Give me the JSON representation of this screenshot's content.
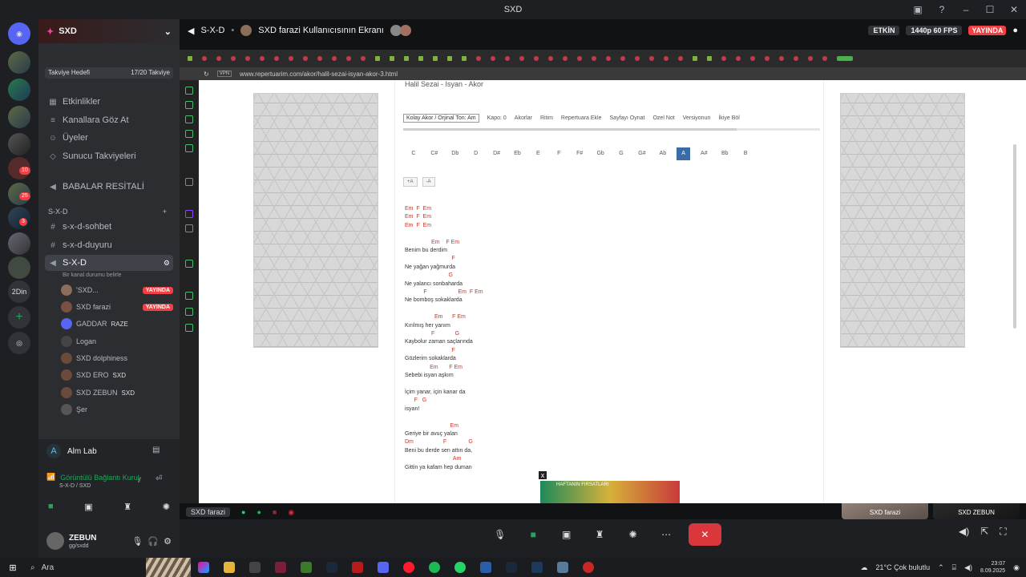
{
  "window": {
    "title": "SXD"
  },
  "server": {
    "name": "SXD",
    "boost_label": "Takviye Hedefi",
    "boost_count": "17/20 Takviye"
  },
  "nav": [
    {
      "label": "Etkinlikler",
      "icon": "calendar-icon"
    },
    {
      "label": "Kanallara Göz At",
      "icon": "browse-icon"
    },
    {
      "label": "Üyeler",
      "icon": "members-icon"
    },
    {
      "label": "Sunucu Takviyeleri",
      "icon": "boost-icon"
    }
  ],
  "channel_top": "BABALAR RESİTALİ",
  "category": "S-X-D",
  "text_channels": [
    "s-x-d-sohbet",
    "s-x-d-duyuru"
  ],
  "voice_channel": {
    "name": "S-X-D",
    "status": "Bir kanal durumu belirle"
  },
  "voice_users": [
    {
      "name": "'SXD...",
      "live": "YAYINDA"
    },
    {
      "name": "SXD farazi",
      "live": "YAYINDA"
    },
    {
      "name": "GADDAR",
      "tag": "RAZE"
    },
    {
      "name": "Logan",
      "tag": ""
    },
    {
      "name": "SXD dolphiness",
      "tag": ""
    },
    {
      "name": "SXD ERO",
      "tag": "SXD"
    },
    {
      "name": "SXD ZEBUN",
      "tag": "SXD"
    },
    {
      "name": "Şer",
      "tag": ""
    }
  ],
  "voice_panel": {
    "app": "Alm Lab",
    "status": "Görüntülü Bağlantı Kurul",
    "sub": "S-X-D / SXD"
  },
  "user": {
    "name": "ZEBUN",
    "status": "gg/sxdd"
  },
  "stream": {
    "title": "S-X-D",
    "viewer": "SXD farazi Kullanıcısının Ekranı",
    "quality": "1440p 60 FPS",
    "live": "YAYINDA",
    "activity": "ETKİN"
  },
  "browser": {
    "url": "www.repertuarim.com/akor/halil-sezai-isyan-akor-3.html"
  },
  "song": {
    "title": "Halil Sezai - Isyan - Akor",
    "select": "Kolay Akor / Orjinal Ton: Am",
    "capo": "Kapo: 0",
    "tools": [
      "Akorlar",
      "Ritim",
      "Repertuara Ekle",
      "Sayfayı Oynat",
      "Ozel Not",
      "Versiyonun",
      "İkiye Böl"
    ],
    "keys": [
      "C",
      "C#",
      "Db",
      "D",
      "D#",
      "Eb",
      "E",
      "F",
      "F#",
      "Gb",
      "G",
      "G#",
      "Ab",
      "A",
      "A#",
      "Bb",
      "B"
    ],
    "active_key": "A",
    "transpose": [
      "+A",
      "-A"
    ],
    "lines": [
      {
        "c": "Em  F  Em"
      },
      {
        "c": "Em  F  Em"
      },
      {
        "c": "Em  F  Em"
      },
      {
        "t": ""
      },
      {
        "c": "                 Em    F Em"
      },
      {
        "t": "Benim bu derdim"
      },
      {
        "c": "                              F"
      },
      {
        "t": "Ne yağan yağmurda"
      },
      {
        "c": "                            G"
      },
      {
        "t": "Ne yalancı sonbaharda"
      },
      {
        "c": "            F                    Em  F Em"
      },
      {
        "t": "Ne bomboş sokaklarda"
      },
      {
        "t": ""
      },
      {
        "c": "                   Em      F Em"
      },
      {
        "t": "Kırılmış her yanım"
      },
      {
        "c": "                 F             G"
      },
      {
        "t": "Kaybolur zaman saçlarında"
      },
      {
        "c": "                              F"
      },
      {
        "t": "Gözlerim sokaklarda"
      },
      {
        "c": "                Em       F Em"
      },
      {
        "t": "Sebebi isyan aşkım"
      },
      {
        "t": ""
      },
      {
        "t": "İçim yanar, için kanar da"
      },
      {
        "c": "      F   G"
      },
      {
        "t": "isyan!"
      },
      {
        "t": ""
      },
      {
        "c": "                             Em"
      },
      {
        "t": "Geriye bir avuç yalan"
      },
      {
        "c": "Dm                   F              G"
      },
      {
        "t": "Beni bu derde sen attın da,"
      },
      {
        "c": "                               Am"
      },
      {
        "t": "Gittin ya kafam hep duman"
      }
    ]
  },
  "webcams": [
    {
      "name": "SXD farazi"
    },
    {
      "name": "SXD ZEBUN"
    }
  ],
  "ad_label": "HAFTANIN FIRSATLARI",
  "stream_tab": "SXD farazi",
  "taskbar": {
    "search": "Ara",
    "weather": "21°C  Çok bulutlu",
    "time": "23:07",
    "date": "8.09.2025"
  }
}
